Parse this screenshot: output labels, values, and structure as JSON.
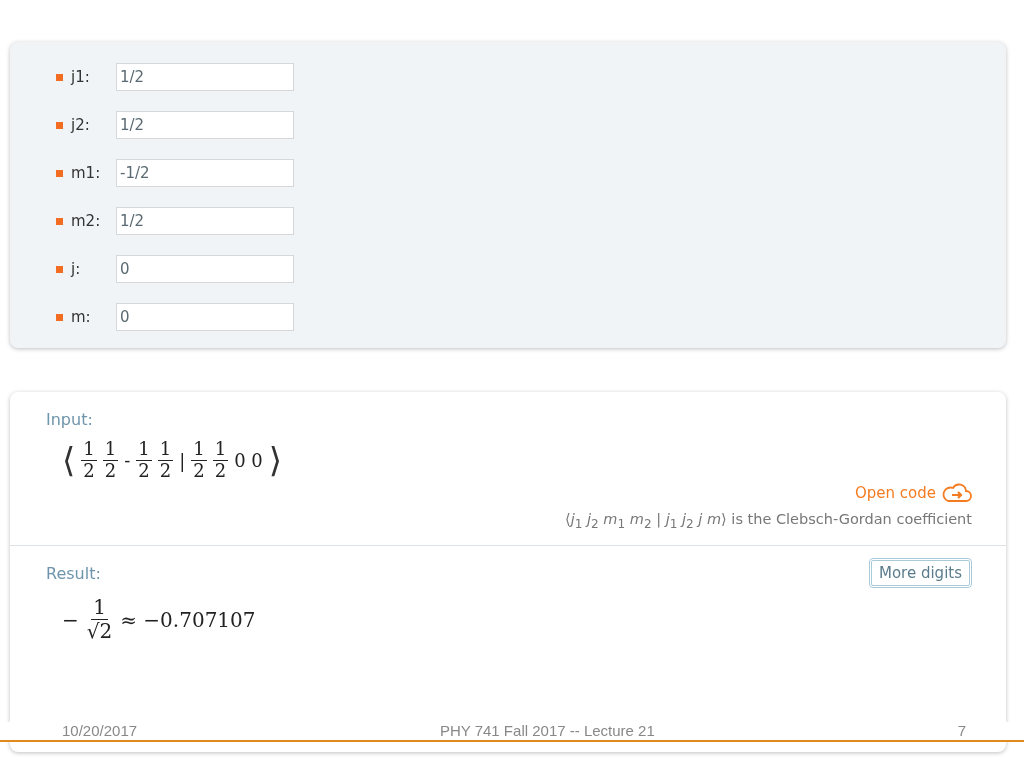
{
  "parameters": [
    {
      "label": "j1:",
      "value": "1/2"
    },
    {
      "label": "j2:",
      "value": "1/2"
    },
    {
      "label": "m1:",
      "value": "-1/2"
    },
    {
      "label": "m2:",
      "value": "1/2"
    },
    {
      "label": "j:",
      "value": "0"
    },
    {
      "label": "m:",
      "value": "0"
    }
  ],
  "input_pod": {
    "title": "Input:",
    "formula": [
      {
        "kind": "bracket",
        "text": "⟨"
      },
      {
        "kind": "fraction",
        "num": "1",
        "den": "2"
      },
      {
        "kind": "fraction",
        "num": "1",
        "den": "2"
      },
      {
        "kind": "symbol",
        "text": "-"
      },
      {
        "kind": "fraction",
        "num": "1",
        "den": "2"
      },
      {
        "kind": "fraction",
        "num": "1",
        "den": "2"
      },
      {
        "kind": "symbol",
        "text": "|"
      },
      {
        "kind": "fraction",
        "num": "1",
        "den": "2"
      },
      {
        "kind": "fraction",
        "num": "1",
        "den": "2"
      },
      {
        "kind": "symbol",
        "text": "0 0"
      },
      {
        "kind": "bracket",
        "text": "⟩"
      }
    ],
    "open_code": "Open code",
    "caption": "⟨*j*$_{1}$ *j*$_{2}$ *m*$_{1}$ *m*$_{2}$ | *j*$_{1}$ *j*$_{2}$ *j m*⟩ is the Clebsch-Gordan coefficient"
  },
  "result_pod": {
    "title": "Result:",
    "button": "More digits",
    "formula": [
      {
        "kind": "symbol",
        "text": "−"
      },
      {
        "kind": "fraction",
        "num": "1",
        "den": "√2"
      },
      {
        "kind": "symbol",
        "text": "≈ −0.707107"
      }
    ]
  },
  "footer": {
    "date": "10/20/2017",
    "title": "PHY 741  Fall 2017 -- Lecture 21",
    "page": "7"
  }
}
